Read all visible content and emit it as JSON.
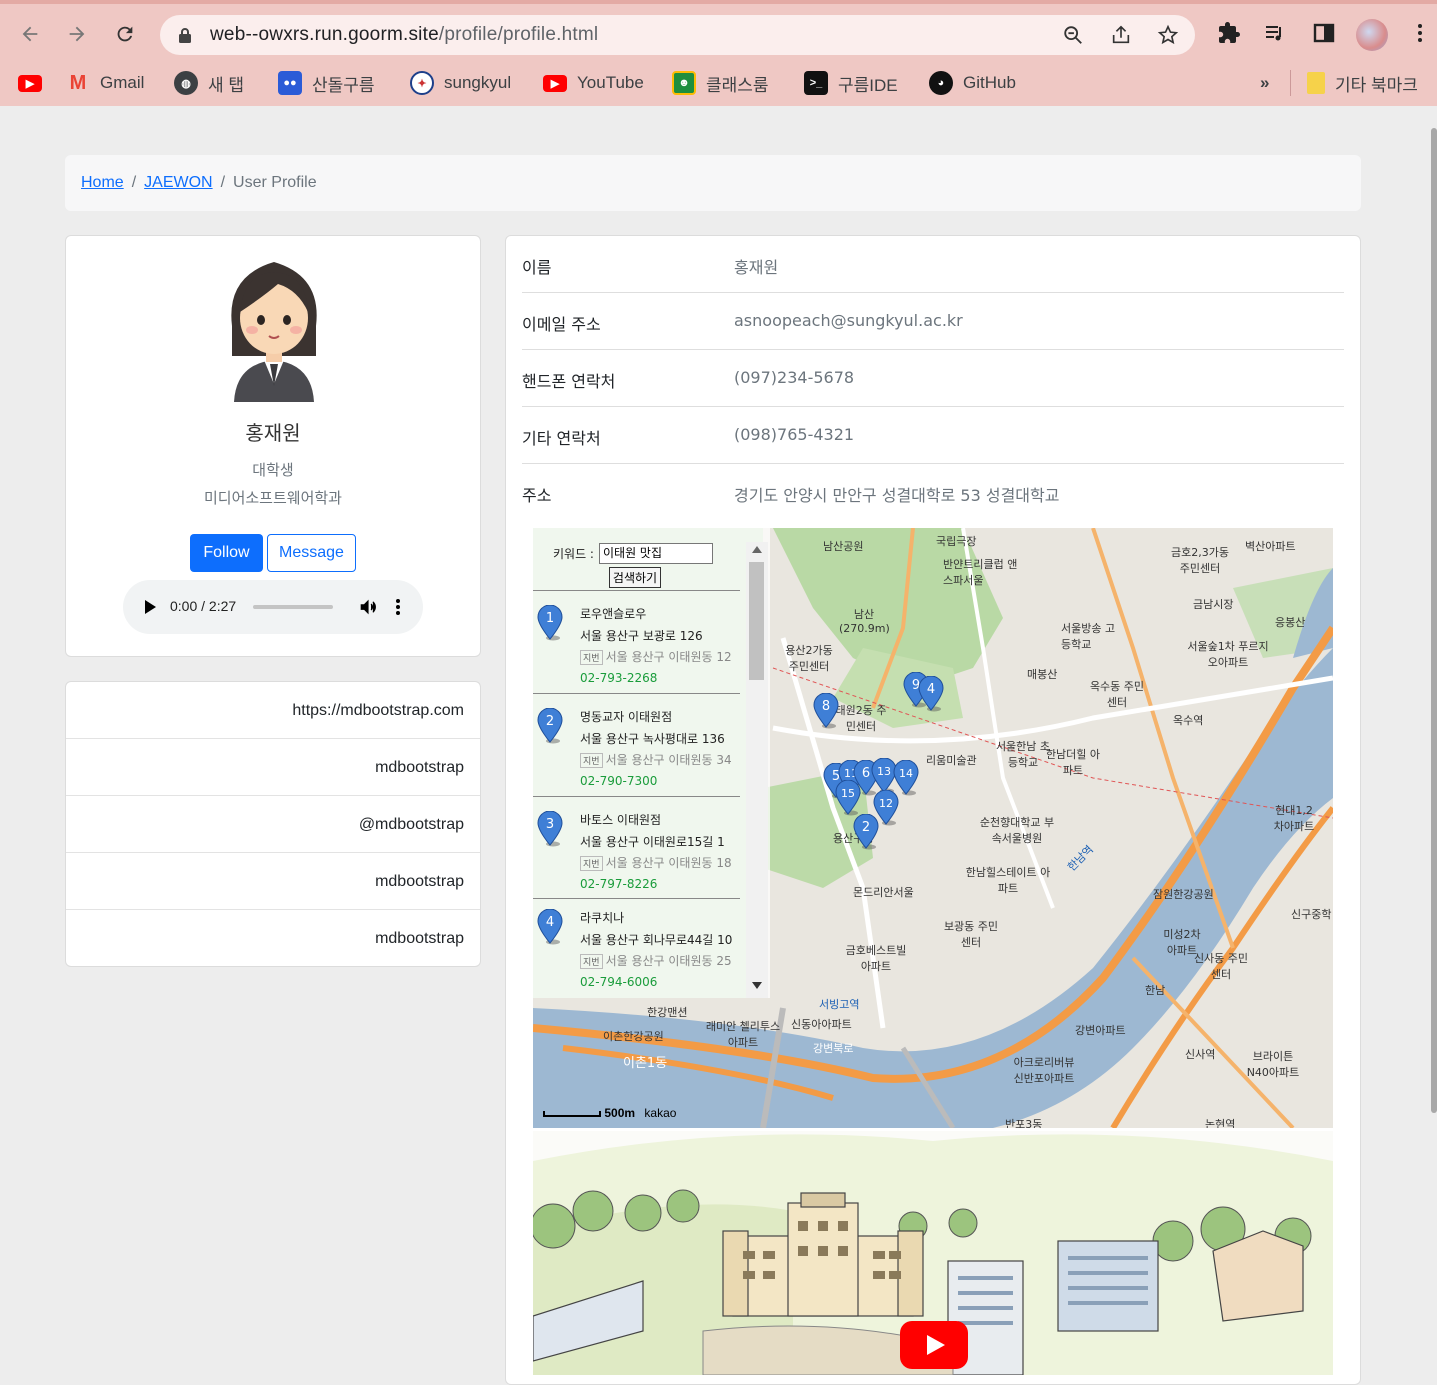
{
  "browser": {
    "url_host": "web--owxrs.run.goorm.site",
    "url_path": "/profile/profile.html",
    "bookmarks": [
      {
        "label": "",
        "icon": "youtube-icon",
        "color": "#ff0000"
      },
      {
        "label": "Gmail",
        "icon": "gmail-icon",
        "color": "#ea4335"
      },
      {
        "label": "새 탭",
        "icon": "globe-icon",
        "color": "#3c4043"
      },
      {
        "label": "산돌구름",
        "icon": "sandoll-icon",
        "color": "#2a5bd7"
      },
      {
        "label": "sungkyul",
        "icon": "sungkyul-icon",
        "color": "#1d3f8a"
      },
      {
        "label": "YouTube",
        "icon": "youtube-icon",
        "color": "#ff0000"
      },
      {
        "label": "클래스룸",
        "icon": "classroom-icon",
        "color": "#1e8e3e"
      },
      {
        "label": "구름IDE",
        "icon": "terminal-icon",
        "color": "#111111"
      },
      {
        "label": "GitHub",
        "icon": "github-icon",
        "color": "#111111"
      }
    ],
    "more_bookmarks": "»",
    "other_bookmarks": "기타 북마크"
  },
  "breadcrumb": {
    "home": "Home",
    "section": "JAEWON",
    "current": "User Profile",
    "separator": "/"
  },
  "profile": {
    "name": "홍재원",
    "role": "대학생",
    "department": "미디어소프트웨어학과",
    "follow_label": "Follow",
    "message_label": "Message",
    "audio_time": "0:00 / 2:27"
  },
  "links": [
    "https://mdbootstrap.com",
    "mdbootstrap",
    "@mdbootstrap",
    "mdbootstrap",
    "mdbootstrap"
  ],
  "info": [
    {
      "label": "이름",
      "value": "홍재원"
    },
    {
      "label": "이메일 주소",
      "value": "asnoopeach@sungkyul.ac.kr"
    },
    {
      "label": "핸드폰 연락처",
      "value": "(097)234-5678"
    },
    {
      "label": "기타 연락처",
      "value": "(098)765-4321"
    },
    {
      "label": "주소",
      "value": "경기도 안양시 만안구 성결대학로 53 성결대학교"
    }
  ],
  "map": {
    "keyword_label": "키워드 :",
    "keyword_value": "이태원 맛집",
    "search_label": "검색하기",
    "results": [
      {
        "num": "1",
        "title": "로우앤슬로우",
        "addr": "서울 용산구 보광로 126",
        "jibun_tag": "지번",
        "jibun": "서울 용산구 이태원동 12",
        "tel": "02-793-2268"
      },
      {
        "num": "2",
        "title": "명동교자 이태원점",
        "addr": "서울 용산구 녹사평대로 136",
        "jibun_tag": "지번",
        "jibun": "서울 용산구 이태원동 34",
        "tel": "02-790-7300"
      },
      {
        "num": "3",
        "title": "바토스 이태원점",
        "addr": "서울 용산구 이태원로15길 1",
        "jibun_tag": "지번",
        "jibun": "서울 용산구 이태원동 18",
        "tel": "02-797-8226"
      },
      {
        "num": "4",
        "title": "라쿠치나",
        "addr": "서울 용산구 회나무로44길 10",
        "jibun_tag": "지번",
        "jibun": "서울 용산구 이태원동 25",
        "tel": "02-794-6006"
      }
    ],
    "markers": [
      "9",
      "4",
      "8",
      "5",
      "11",
      "6",
      "13",
      "14",
      "15",
      "12",
      "2"
    ],
    "labels": [
      "남산공원",
      "국립극장",
      "반얀트리클럽 앤스파서울",
      "금호2,3가동 주민센터",
      "벽산아파트",
      "남산 (270.9m)",
      "서울방송 고등학교",
      "금남시장",
      "응봉산",
      "서울숲1차 푸르지오아파트",
      "용산2가동 주민센터",
      "매봉산",
      "옥수동 주민센터",
      "옥수역",
      "태원2동 주민센터",
      "리움미술관",
      "서울한남 초등학교",
      "한남더힐 아파트",
      "순천향대학교 부속서울병원",
      "한남힐스테이트 아파트",
      "현대1,2 차아파트",
      "몬드리안서울",
      "보광동 주민센터",
      "잠원한강공원",
      "신구중학",
      "금호베스트빌 아파트",
      "미성2차 아파트",
      "신사동 주민센터",
      "한강맨션",
      "래미안 첼리투스아파트",
      "신동아아파트",
      "이촌한강공원",
      "한남",
      "강변아파트",
      "신사역",
      "브라이튼 N40아파트",
      "아크로리버뷰 신반포아파트",
      "반포3동",
      "논현역",
      "용산구청",
      "한남역",
      "서빙고역",
      "강변북로",
      "이촌1동"
    ],
    "scale_label": "500m",
    "attribution": "kakao"
  }
}
